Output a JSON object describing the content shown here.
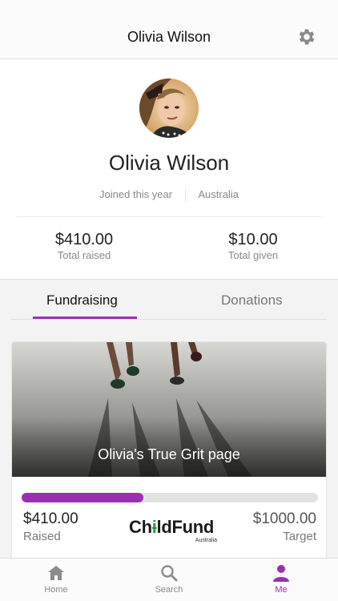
{
  "header": {
    "title": "Olivia Wilson"
  },
  "profile": {
    "name": "Olivia Wilson",
    "joined": "Joined this year",
    "location": "Australia",
    "total_raised": {
      "value": "$410.00",
      "label": "Total raised"
    },
    "total_given": {
      "value": "$10.00",
      "label": "Total given"
    }
  },
  "tabs": [
    {
      "label": "Fundraising",
      "active": true
    },
    {
      "label": "Donations",
      "active": false
    }
  ],
  "card": {
    "title": "Olivia's True Grit page",
    "progress_fraction": 0.41,
    "raised": {
      "value": "$410.00",
      "label": "Raised"
    },
    "target": {
      "value": "$1000.00",
      "label": "Target"
    },
    "charity_logo": {
      "name": "ChildFund",
      "sub": "Australia"
    }
  },
  "bottom_nav": [
    {
      "label": "Home",
      "icon": "home-icon",
      "active": false
    },
    {
      "label": "Search",
      "icon": "search-icon",
      "active": false
    },
    {
      "label": "Me",
      "icon": "person-icon",
      "active": true
    }
  ],
  "colors": {
    "accent": "#9b2fb1",
    "muted": "#888888"
  }
}
